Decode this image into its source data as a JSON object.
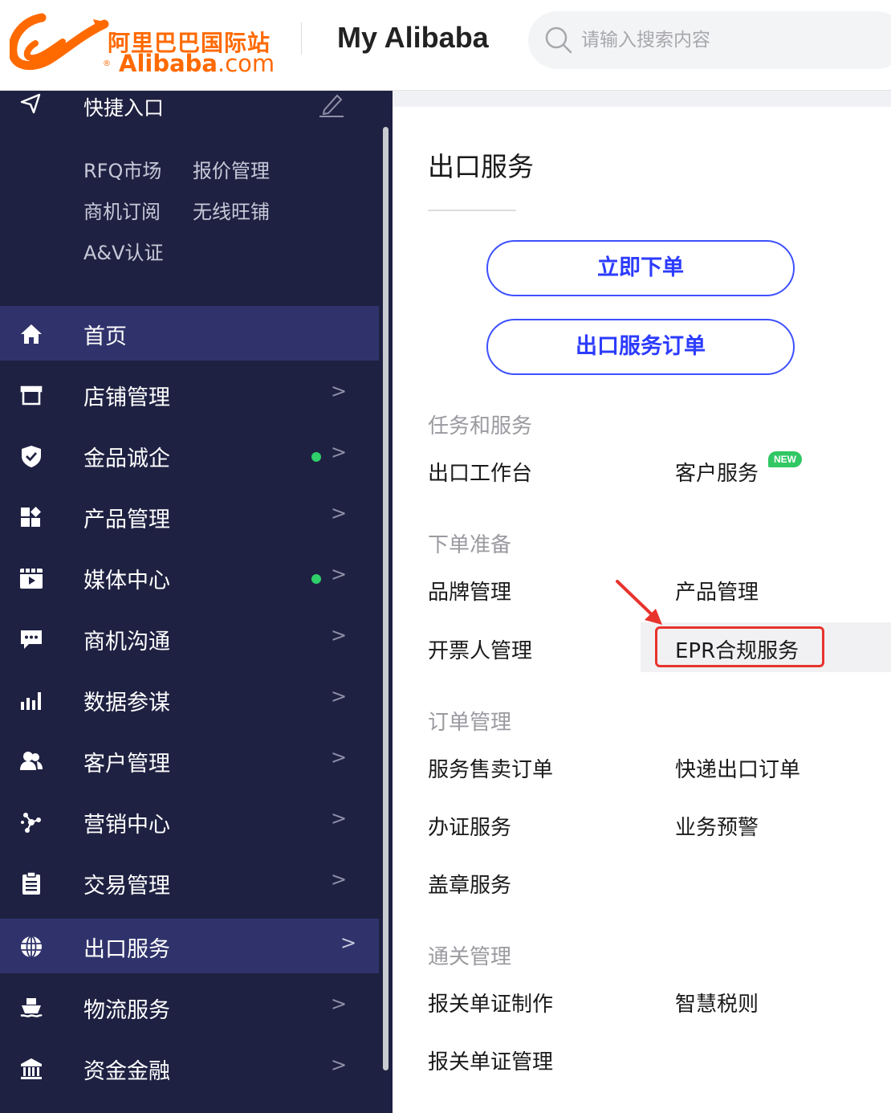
{
  "header": {
    "logo_cn": "阿里巴巴国际站",
    "logo_en_brand": "Alibaba",
    "logo_en_tld": ".com",
    "logo_reg": "®",
    "title": "My Alibaba",
    "search_placeholder": "请输入搜索内容",
    "brand_color": "#ff6a00"
  },
  "sidebar": {
    "quick_title": "快捷入口",
    "shortcuts": [
      "RFQ市场",
      "报价管理",
      "商机订阅",
      "无线旺铺",
      "A&V认证"
    ],
    "items": [
      {
        "label": "首页",
        "icon": "home-icon",
        "arrow": "",
        "dot": false,
        "active": true
      },
      {
        "label": "店铺管理",
        "icon": "store-icon",
        "arrow": ">",
        "dot": false,
        "active": false
      },
      {
        "label": "金品诚企",
        "icon": "shield-check-icon",
        "arrow": ">",
        "dot": true,
        "active": false
      },
      {
        "label": "产品管理",
        "icon": "product-grid-icon",
        "arrow": ">",
        "dot": false,
        "active": false
      },
      {
        "label": "媒体中心",
        "icon": "media-play-icon",
        "arrow": ">",
        "dot": true,
        "active": false
      },
      {
        "label": "商机沟通",
        "icon": "chat-bubble-icon",
        "arrow": ">",
        "dot": false,
        "active": false
      },
      {
        "label": "数据参谋",
        "icon": "bar-chart-icon",
        "arrow": ">",
        "dot": false,
        "active": false
      },
      {
        "label": "客户管理",
        "icon": "users-icon",
        "arrow": ">",
        "dot": false,
        "active": false
      },
      {
        "label": "营销中心",
        "icon": "network-icon",
        "arrow": ">",
        "dot": false,
        "active": false
      },
      {
        "label": "交易管理",
        "icon": "clipboard-icon",
        "arrow": ">",
        "dot": false,
        "active": false
      },
      {
        "label": "出口服务",
        "icon": "globe-icon",
        "arrow": ">",
        "dot": false,
        "active": true
      },
      {
        "label": "物流服务",
        "icon": "ship-icon",
        "arrow": ">",
        "dot": false,
        "active": false
      },
      {
        "label": "资金金融",
        "icon": "bank-icon",
        "arrow": ">",
        "dot": false,
        "active": false
      }
    ]
  },
  "main": {
    "title": "出口服务",
    "btn_order_now": "立即下单",
    "btn_export_orders": "出口服务订单",
    "new_badge": "NEW",
    "sections": {
      "tasks": {
        "title": "任务和服务",
        "items": [
          "出口工作台",
          "客户服务"
        ]
      },
      "prep": {
        "title": "下单准备",
        "items": [
          "品牌管理",
          "产品管理",
          "开票人管理",
          "EPR合规服务"
        ]
      },
      "orders": {
        "title": "订单管理",
        "items": [
          "服务售卖订单",
          "快递出口订单",
          "办证服务",
          "业务预警",
          "盖章服务"
        ]
      },
      "customs": {
        "title": "通关管理",
        "items": [
          "报关单证制作",
          "智慧税则",
          "报关单证管理"
        ]
      }
    },
    "highlight_color": "#e8332c",
    "accent_color": "#3d50ff"
  }
}
